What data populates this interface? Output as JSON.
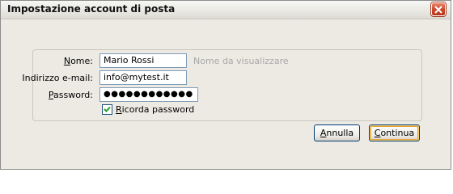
{
  "dialog": {
    "title": "Impostazione account di posta"
  },
  "form": {
    "name_label": "Nome:",
    "name_value": "Mario Rossi",
    "name_hint": "Nome da visualizzare",
    "email_label": "Indirizzo e-mail:",
    "email_value": "info@mytest.it",
    "password_label": "Password:",
    "password_value": "●●●●●●●●●●●●",
    "remember_label": "Ricorda password",
    "remember_checked": true
  },
  "buttons": {
    "cancel_label": "Annulla",
    "continue_label": "Continua"
  },
  "icons": {
    "close": "close-icon",
    "check": "checkmark-icon"
  },
  "colors": {
    "close_button": "#c9452a",
    "field_border": "#7f9db9",
    "default_button_glow": "#e5a53a"
  }
}
